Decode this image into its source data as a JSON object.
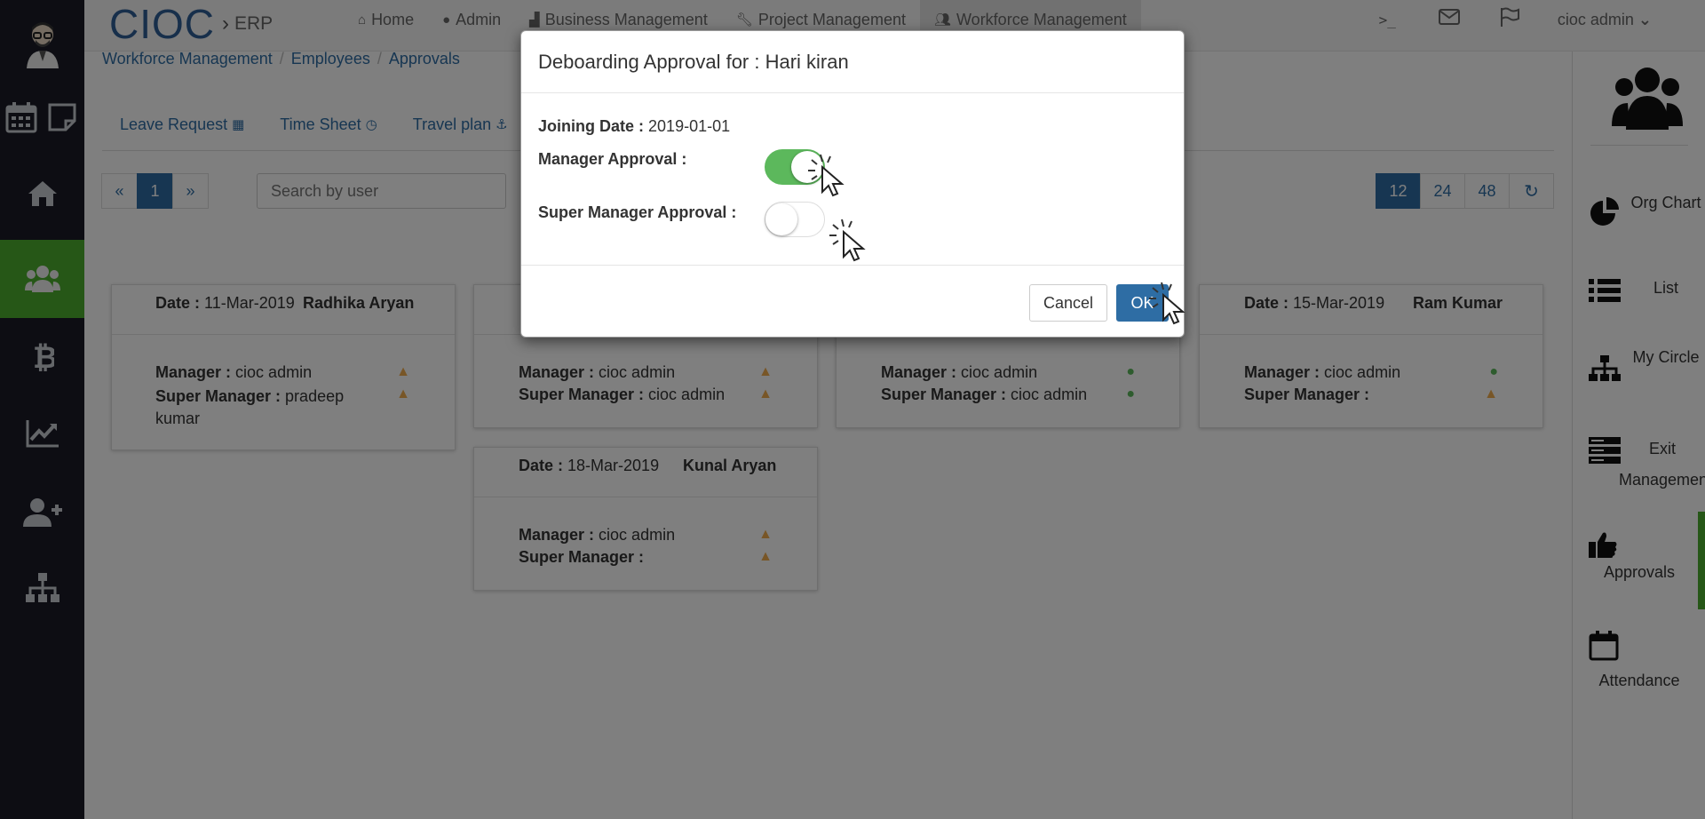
{
  "brand": {
    "name": "CIOC",
    "separator": "›",
    "product": "ERP"
  },
  "topnav": {
    "items": [
      {
        "label": "Home",
        "icon": "home-icon"
      },
      {
        "label": "Admin",
        "icon": "user-icon"
      },
      {
        "label": "Business Management",
        "icon": "industry-icon"
      },
      {
        "label": "Project Management",
        "icon": "wrench-icon"
      },
      {
        "label": "Workforce Management",
        "icon": "users-icon"
      }
    ],
    "terminal": ">_",
    "user": "cioc admin"
  },
  "breadcrumb": [
    "Workforce Management",
    "Employees",
    "Approvals"
  ],
  "subtabs": [
    {
      "label": "Leave Request",
      "icon": "calendar-icon"
    },
    {
      "label": "Time Sheet",
      "icon": "clock-icon"
    },
    {
      "label": "Travel plan",
      "icon": "anchor-icon"
    }
  ],
  "pager": {
    "prev": "«",
    "current": "1",
    "next": "»"
  },
  "search": {
    "placeholder": "Search by user"
  },
  "perpage": [
    "12",
    "24",
    "48"
  ],
  "cards": [
    {
      "date_label": "Date :",
      "date": "11-Mar-2019",
      "name": "Radhika Aryan",
      "manager_label": "Manager :",
      "manager": "cioc admin",
      "super_label": "Super Manager :",
      "super_manager": "pradeep kumar",
      "manager_status": "warning",
      "super_status": "warning"
    },
    {
      "date_label": "",
      "date": "",
      "name": "",
      "manager_label": "Manager :",
      "manager": "cioc admin",
      "super_label": "Super Manager :",
      "super_manager": "cioc admin",
      "manager_status": "warning",
      "super_status": "warning"
    },
    {
      "date_label": "",
      "date": "",
      "name": "",
      "manager_label": "Manager :",
      "manager": "cioc admin",
      "super_label": "Super Manager :",
      "super_manager": "cioc admin",
      "manager_status": "ok",
      "super_status": "ok"
    },
    {
      "date_label": "Date :",
      "date": "15-Mar-2019",
      "name": "Ram Kumar",
      "manager_label": "Manager :",
      "manager": "cioc admin",
      "super_label": "Super Manager :",
      "super_manager": "",
      "manager_status": "ok",
      "super_status": "warning"
    },
    {
      "date_label": "Date :",
      "date": "18-Mar-2019",
      "name": "Kunal Aryan",
      "manager_label": "Manager :",
      "manager": "cioc admin",
      "super_label": "Super Manager :",
      "super_manager": "",
      "manager_status": "warning",
      "super_status": "warning"
    }
  ],
  "rightbar": [
    {
      "label": "Org Chart",
      "icon": "pie-chart-icon"
    },
    {
      "label": "List",
      "icon": "list-icon"
    },
    {
      "label": "My Circle",
      "icon": "sitemap-icon"
    },
    {
      "label": "Exit Management",
      "icon": "server-icon"
    },
    {
      "label": "Approvals",
      "icon": "thumbs-up-icon"
    },
    {
      "label": "Attendance",
      "icon": "calendar-icon"
    }
  ],
  "modal": {
    "title": "Deboarding Approval for : Hari kiran",
    "joining_label": "Joining Date :",
    "joining_date": "2019-01-01",
    "manager_approval_label": "Manager Approval :",
    "manager_approval": true,
    "super_manager_approval_label": "Super Manager Approval :",
    "super_manager_approval": false,
    "cancel_label": "Cancel",
    "ok_label": "OK"
  },
  "colors": {
    "sidebar": "#1a1b27",
    "accent_green": "#4cae2f",
    "primary": "#2e6da4",
    "warning": "#f0ad4e",
    "success": "#5cb85c"
  }
}
